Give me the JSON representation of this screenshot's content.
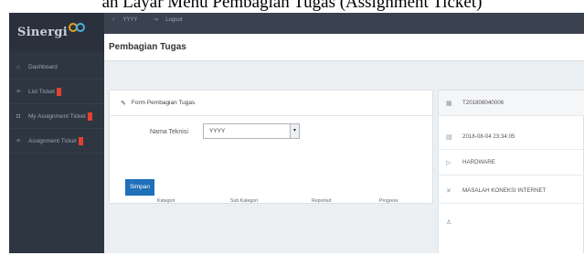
{
  "caption": "an Layar Menu Pembagian Tugas (Assignment Ticket)",
  "app": {
    "brand": "Sinergi",
    "topnav": [
      {
        "icon": "user-icon",
        "label": "YYYY"
      },
      {
        "icon": "logout-icon",
        "label": "Logout"
      }
    ]
  },
  "sidebar": {
    "items": [
      {
        "icon": "dashboard-icon",
        "label": "Dashboard",
        "badge": false
      },
      {
        "icon": "list-icon",
        "label": "List Ticket",
        "badge": true
      },
      {
        "icon": "assignment-icon",
        "label": "My Assignment Ticket",
        "badge": true
      },
      {
        "icon": "list-icon",
        "label": "Assignment Ticket",
        "badge": true
      }
    ],
    "badge_color": "#e2412f"
  },
  "page": {
    "title": "Pembagian Tugas"
  },
  "form": {
    "title": "Form Pembagian Tugas",
    "technician_label": "Nama Teknisi",
    "technician_value": "YYYY",
    "save_label": "Simpan",
    "table_headers": [
      "Kategori",
      "Sub Kategori",
      "Reported",
      "Progress"
    ]
  },
  "ticket_info": {
    "ticket_id": "T201808040006",
    "datetime": "2018-08-04 23:34:05",
    "category": "HARDWARE",
    "issue": "MASALAH KONEKSI INTERNET",
    "assignee": ""
  },
  "colors": {
    "accent": "#1f6fb9",
    "sidebar": "#2e3641",
    "topbar": "#3a4250"
  }
}
